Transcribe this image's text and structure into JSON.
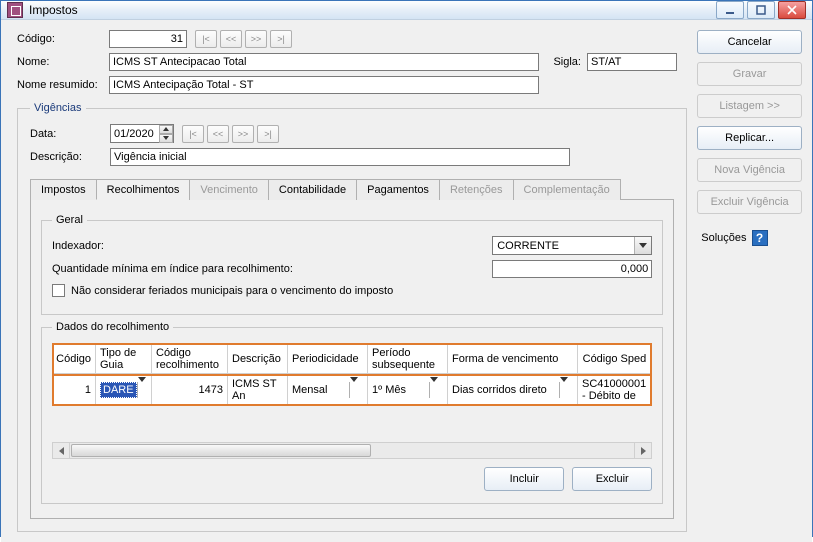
{
  "window": {
    "title": "Impostos"
  },
  "labels": {
    "codigo": "Código:",
    "nome": "Nome:",
    "sigla": "Sigla:",
    "nome_resumido": "Nome resumido:",
    "data": "Data:",
    "descricao": "Descrição:",
    "indexador": "Indexador:",
    "quantidade": "Quantidade mínima em índice para recolhimento:",
    "checkbox": "Não considerar feriados municipais para o vencimento do imposto"
  },
  "values": {
    "codigo": "31",
    "nome": "ICMS ST Antecipacao Total",
    "sigla": "ST/AT",
    "nome_resumido": "ICMS Antecipação Total - ST",
    "data": "01/2020",
    "descricao": "Vigência inicial",
    "indexador": "CORRENTE",
    "quantidade": "0,000"
  },
  "groups": {
    "vigencias": "Vigências",
    "geral": "Geral",
    "dados_recolhimento": "Dados do recolhimento"
  },
  "tabs": [
    {
      "label": "Impostos",
      "enabled": true,
      "active": false
    },
    {
      "label": "Recolhimentos",
      "enabled": true,
      "active": true
    },
    {
      "label": "Vencimento",
      "enabled": false,
      "active": false
    },
    {
      "label": "Contabilidade",
      "enabled": true,
      "active": false
    },
    {
      "label": "Pagamentos",
      "enabled": true,
      "active": false
    },
    {
      "label": "Retenções",
      "enabled": false,
      "active": false
    },
    {
      "label": "Complementação",
      "enabled": false,
      "active": false
    }
  ],
  "table": {
    "headers": {
      "codigo": "Código",
      "tipo_guia": "Tipo de Guia",
      "codigo_recolhimento": "Código recolhimento",
      "descricao": "Descrição",
      "periodicidade": "Periodicidade",
      "periodo_subsequente": "Período subsequente",
      "forma_vencimento": "Forma de vencimento",
      "codigo_sped": "Código Sped"
    },
    "row": {
      "codigo": "1",
      "tipo_guia": "DARE",
      "codigo_recolhimento": "1473",
      "descricao": "ICMS ST An",
      "periodicidade": "Mensal",
      "periodo_subsequente": "1º Mês",
      "forma_vencimento": "Dias corridos direto",
      "codigo_sped": "SC41000001 - Débito de"
    }
  },
  "buttons": {
    "incluir": "Incluir",
    "excluir": "Excluir",
    "cancelar": "Cancelar",
    "gravar": "Gravar",
    "listagem": "Listagem >>",
    "replicar": "Replicar...",
    "nova_vigencia": "Nova Vigência",
    "excluir_vigencia": "Excluir Vigência",
    "solucoes": "Soluções"
  }
}
